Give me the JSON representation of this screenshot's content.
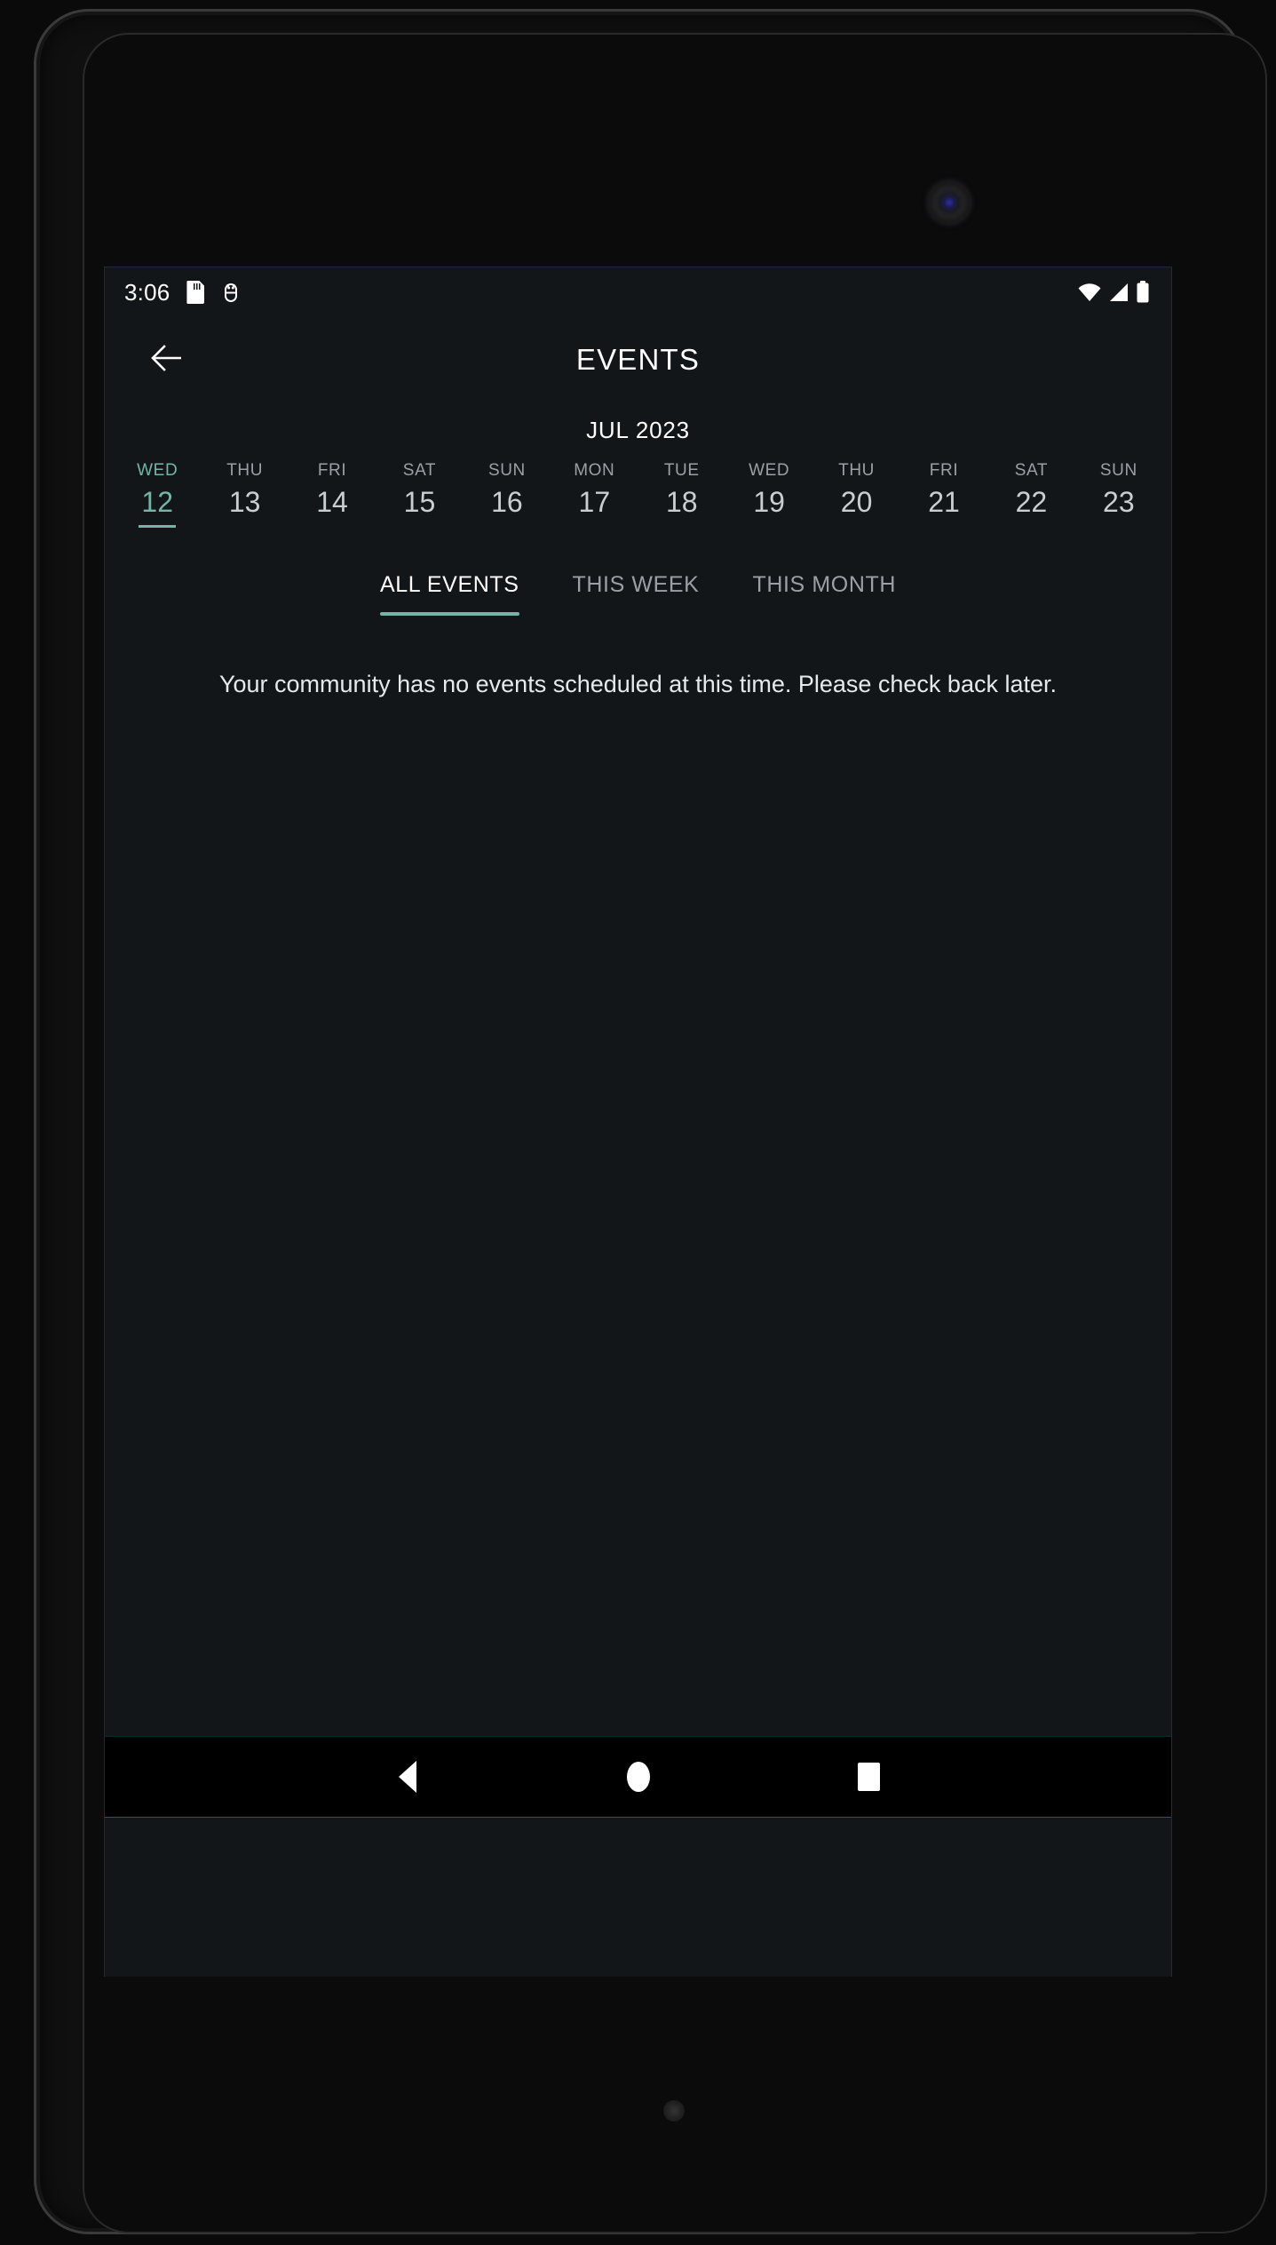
{
  "theme": {
    "screen_bg": "#121619",
    "accent": "#73b5a9",
    "primary_text": "#ffffff",
    "secondary_text": "#9aa0a3",
    "date_text": "#c9ced1",
    "nav_bg": "#000000"
  },
  "status_bar": {
    "clock": "3:06",
    "left_icons": [
      "sd-card-icon",
      "android-debug-icon"
    ],
    "right_icons": [
      "wifi-icon",
      "cellular-signal-icon",
      "battery-icon"
    ]
  },
  "app_bar": {
    "back_icon": "arrow-left-icon",
    "title": "EVENTS"
  },
  "calendar": {
    "month_label": "JUL 2023",
    "days": [
      {
        "dow": "WED",
        "num": "12",
        "selected": true
      },
      {
        "dow": "THU",
        "num": "13",
        "selected": false
      },
      {
        "dow": "FRI",
        "num": "14",
        "selected": false
      },
      {
        "dow": "SAT",
        "num": "15",
        "selected": false
      },
      {
        "dow": "SUN",
        "num": "16",
        "selected": false
      },
      {
        "dow": "MON",
        "num": "17",
        "selected": false
      },
      {
        "dow": "TUE",
        "num": "18",
        "selected": false
      },
      {
        "dow": "WED",
        "num": "19",
        "selected": false
      },
      {
        "dow": "THU",
        "num": "20",
        "selected": false
      },
      {
        "dow": "FRI",
        "num": "21",
        "selected": false
      },
      {
        "dow": "SAT",
        "num": "22",
        "selected": false
      },
      {
        "dow": "SUN",
        "num": "23",
        "selected": false
      }
    ]
  },
  "tabs": [
    {
      "label": "ALL EVENTS",
      "active": true
    },
    {
      "label": "THIS WEEK",
      "active": false
    },
    {
      "label": "THIS MONTH",
      "active": false
    }
  ],
  "content": {
    "empty_message": "Your community has no events scheduled at this time. Please check back later."
  },
  "nav_bar": {
    "back_label": "back-triangle-icon",
    "home_label": "home-circle-icon",
    "recents_label": "recents-square-icon"
  }
}
